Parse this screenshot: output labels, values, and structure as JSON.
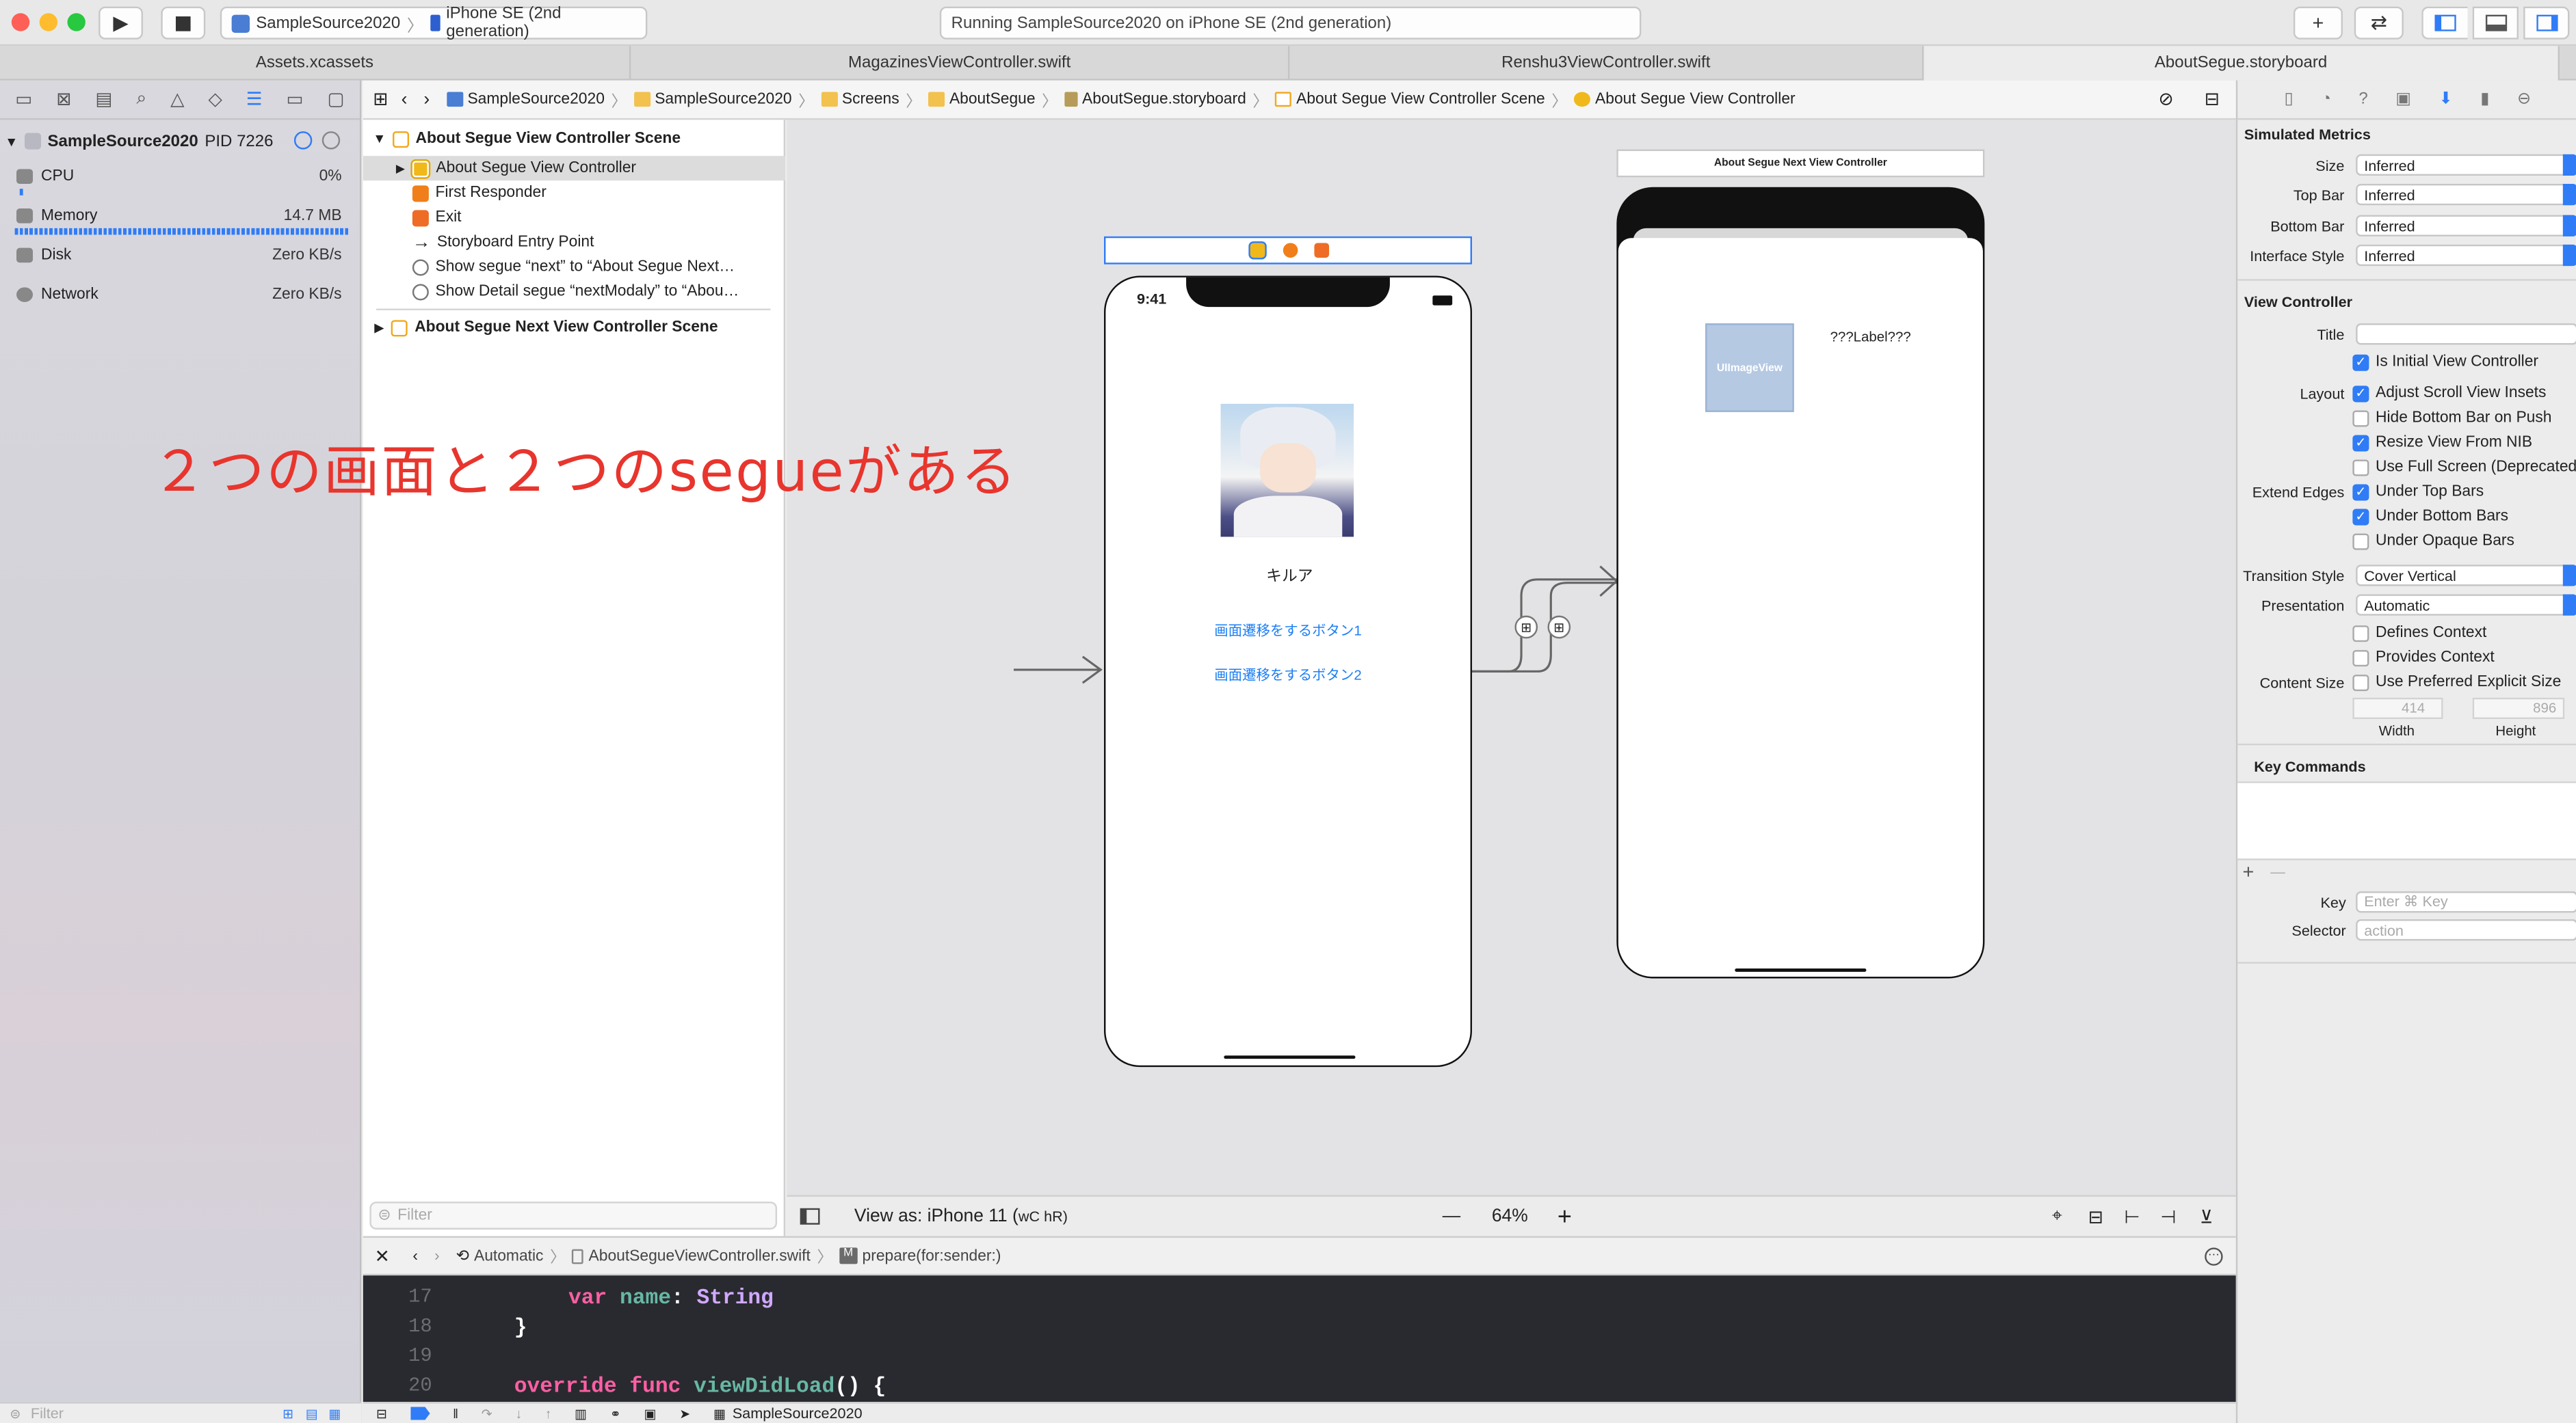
{
  "toolbar": {
    "scheme": "SampleSource2020",
    "device": "iPhone SE (2nd generation)",
    "status": "Running SampleSource2020 on iPhone SE (2nd generation)"
  },
  "tabs": [
    "Assets.xcassets",
    "MagazinesViewController.swift",
    "Renshu3ViewController.swift",
    "AboutSegue.storyboard"
  ],
  "debug_nav": {
    "process": "SampleSource2020",
    "pid": "PID 7226",
    "gauges": [
      {
        "label": "CPU",
        "value": "0%"
      },
      {
        "label": "Memory",
        "value": "14.7 MB"
      },
      {
        "label": "Disk",
        "value": "Zero KB/s"
      },
      {
        "label": "Network",
        "value": "Zero KB/s"
      }
    ],
    "filter_placeholder": "Filter"
  },
  "jumpbar": {
    "crumbs": [
      "SampleSource2020",
      "SampleSource2020",
      "Screens",
      "AboutSegue",
      "AboutSegue.storyboard",
      "About Segue View Controller Scene",
      "About Segue View Controller"
    ]
  },
  "outline": {
    "scene1": "About Segue View Controller Scene",
    "items": [
      "About Segue View Controller",
      "First Responder",
      "Exit",
      "Storyboard Entry Point",
      "Show segue “next” to “About Segue Next…",
      "Show Detail segue “nextModaly” to “Abou…"
    ],
    "scene2": "About Segue Next View Controller Scene",
    "filter_placeholder": "Filter"
  },
  "annotation": "２つの画面と２つのsegueがある",
  "canvas": {
    "phone1": {
      "time": "9:41",
      "name_label": "キルア",
      "button1": "画面遷移をするボタン1",
      "button2": "画面遷移をするボタン2"
    },
    "phone2": {
      "title": "About Segue Next View Controller",
      "imageview": "UIImageView",
      "label": "???Label???"
    },
    "view_as": "View as: iPhone 11 (",
    "view_as_traits": "wC hR)",
    "zoom": "64%",
    "zoom_minus": "—",
    "zoom_plus": "+"
  },
  "inspector": {
    "sim_metrics": "Simulated Metrics",
    "size_label": "Size",
    "size_value": "Inferred",
    "topbar_label": "Top Bar",
    "topbar_value": "Inferred",
    "bottombar_label": "Bottom Bar",
    "bottombar_value": "Inferred",
    "istyle_label": "Interface Style",
    "istyle_value": "Inferred",
    "vc_header": "View Controller",
    "title_label": "Title",
    "initial": "Is Initial View Controller",
    "layout_label": "Layout",
    "adjust": "Adjust Scroll View Insets",
    "hidebottom": "Hide Bottom Bar on Push",
    "resize": "Resize View From NIB",
    "fullscreen": "Use Full Screen (Deprecated)",
    "extend_label": "Extend Edges",
    "under_top": "Under Top Bars",
    "under_bottom": "Under Bottom Bars",
    "under_opaque": "Under Opaque Bars",
    "transition_label": "Transition Style",
    "transition_value": "Cover Vertical",
    "presentation_label": "Presentation",
    "presentation_value": "Automatic",
    "defines": "Defines Context",
    "provides": "Provides Context",
    "content_label": "Content Size",
    "preferred": "Use Preferred Explicit Size",
    "width_value": "414",
    "height_value": "896",
    "width_label": "Width",
    "height_label": "Height",
    "key_commands": "Key Commands",
    "plus": "+",
    "minus": "—",
    "key_label": "Key",
    "key_placeholder": "Enter ⌘ Key",
    "selector_label": "Selector",
    "selector_placeholder": "action"
  },
  "editor": {
    "jump": [
      "Automatic",
      "AboutSegueViewController.swift",
      "prepare(for:sender:)"
    ],
    "method_badge": "M",
    "lines": [
      {
        "n": "17",
        "kw": "var",
        "name": "name",
        "sep": ": ",
        "type": "String"
      },
      {
        "n": "18",
        "text": "}"
      },
      {
        "n": "19",
        "text": ""
      },
      {
        "n": "20",
        "kw": "override func",
        "fn": "viewDidLoad",
        "rest": "() {"
      }
    ]
  },
  "debugbar": {
    "target": "SampleSource2020"
  },
  "colors": {
    "accent": "#2f7cf6",
    "annotation": "#e8352d",
    "link": "#1b7ef5",
    "code_bg": "#292a30"
  }
}
